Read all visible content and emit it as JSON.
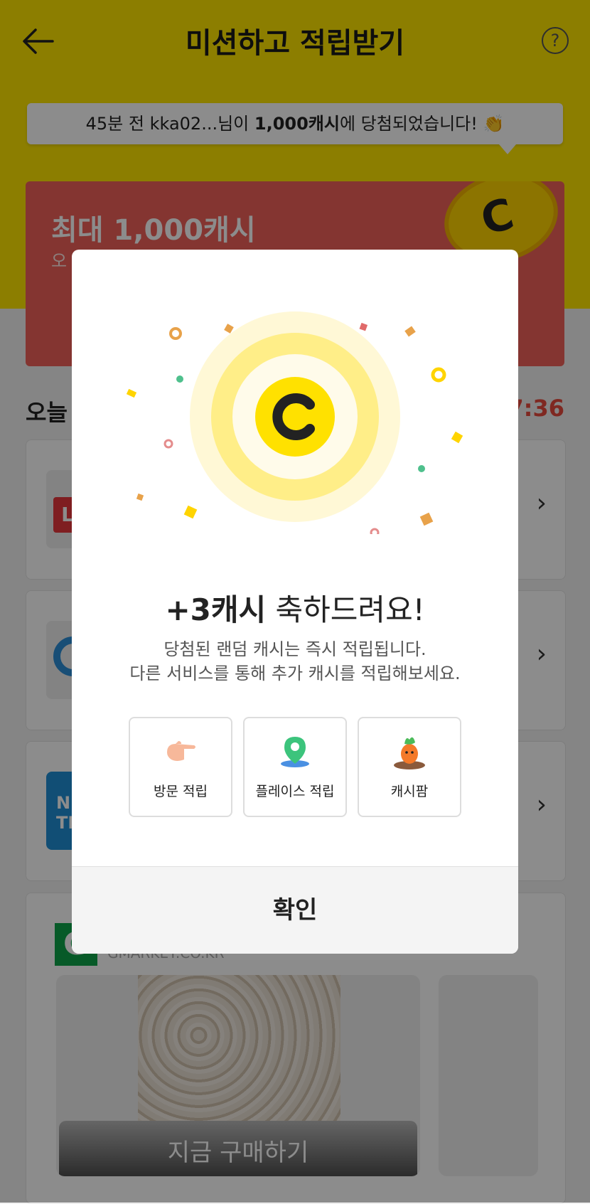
{
  "header": {
    "title": "미션하고 적립받기",
    "help": "?"
  },
  "ticker": {
    "prefix": "45분 전 kka02...님이 ",
    "amount": "1,000캐시",
    "suffix": "에 당첨되었습니다! 👏"
  },
  "promo": {
    "title": "최대 1,000캐시",
    "subtitle": "오",
    "coin": "C"
  },
  "section": {
    "title": "오늘",
    "timer": "7:36"
  },
  "list": [
    {
      "badge": "L"
    },
    {
      "badge": "O"
    },
    {
      "badge": "N\nTI"
    }
  ],
  "shop": {
    "logo": "G",
    "site": "GMARKET.CO.KR",
    "buy_label": "지금 구매하기"
  },
  "modal": {
    "coin": "C",
    "title_amount": "+3캐시",
    "title_rest": " 축하드려요!",
    "desc_line1": "당첨된 랜덤 캐시는 즉시 적립됩니다.",
    "desc_line2": "다른 서비스를 통해 추가 캐시를 적립해보세요.",
    "options": [
      {
        "label": "방문 적립",
        "icon": "pointing-hand-icon"
      },
      {
        "label": "플레이스 적립",
        "icon": "map-pin-icon"
      },
      {
        "label": "캐시팜",
        "icon": "carrot-icon"
      }
    ],
    "confirm_label": "확인"
  },
  "colors": {
    "accent": "#ffe600",
    "promo": "#f0625a",
    "timer": "#e84a3c"
  }
}
